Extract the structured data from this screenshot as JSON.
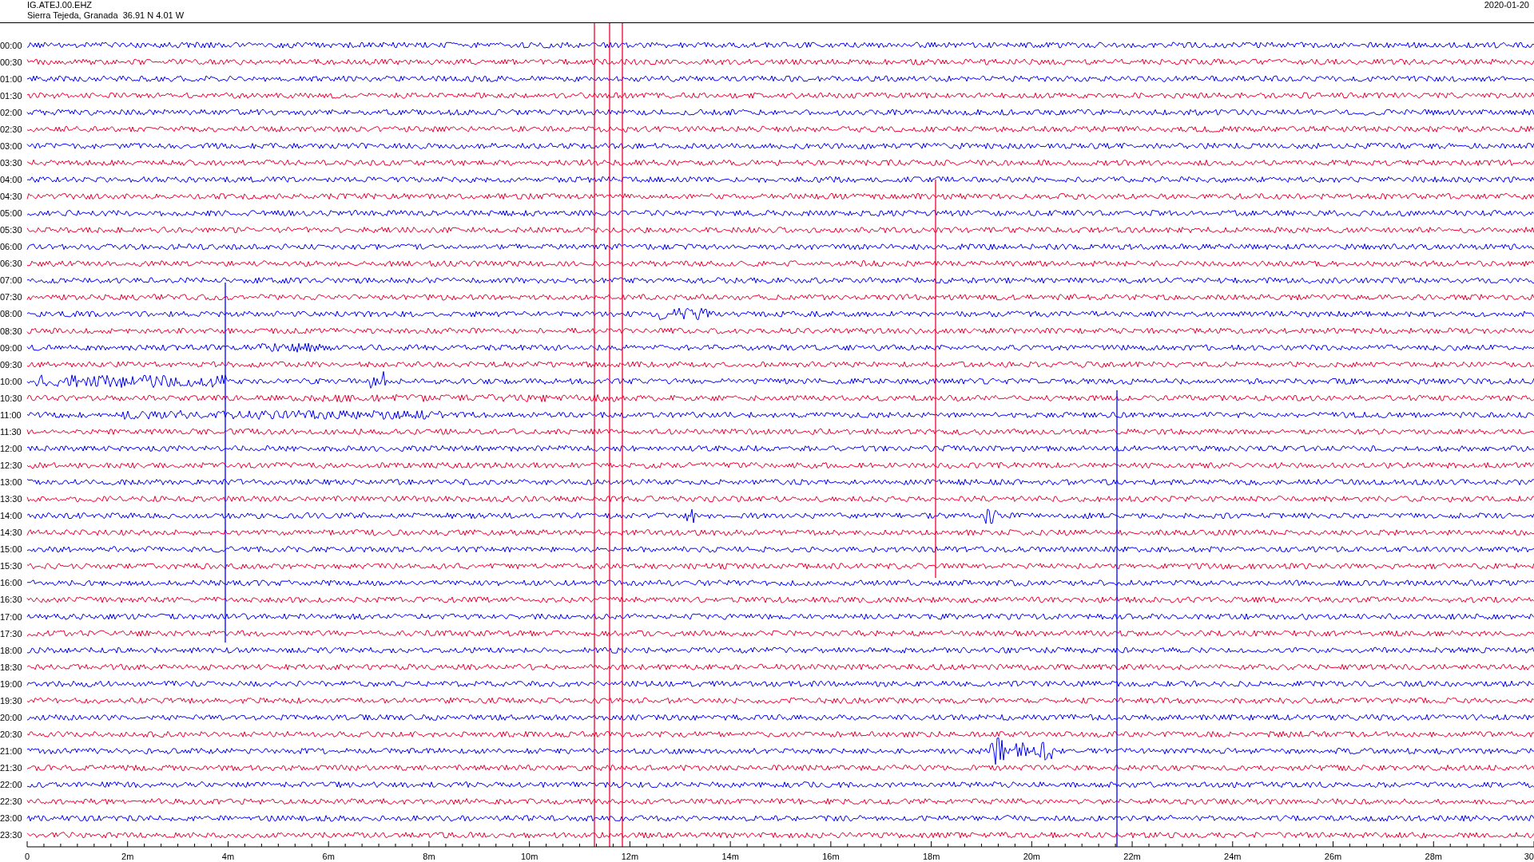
{
  "station": {
    "code": "IG.ATEJ.00.EHZ",
    "location": "Sierra Tejeda, Granada  36.91 N 4.01 W",
    "date": "2020-01-20"
  },
  "traces": [
    {
      "time": "00:00",
      "color": "#0000ff"
    },
    {
      "time": "00:30",
      "color": "#f00030"
    },
    {
      "time": "01:00",
      "color": "#0000ff"
    },
    {
      "time": "01:30",
      "color": "#f00030"
    },
    {
      "time": "02:00",
      "color": "#0000ff"
    },
    {
      "time": "02:30",
      "color": "#f00030"
    },
    {
      "time": "03:00",
      "color": "#0000ff"
    },
    {
      "time": "03:30",
      "color": "#f00030"
    },
    {
      "time": "04:00",
      "color": "#0000ff"
    },
    {
      "time": "04:30",
      "color": "#f00030"
    },
    {
      "time": "05:00",
      "color": "#0000ff"
    },
    {
      "time": "05:30",
      "color": "#f00030"
    },
    {
      "time": "06:00",
      "color": "#0000ff"
    },
    {
      "time": "06:30",
      "color": "#f00030"
    },
    {
      "time": "07:00",
      "color": "#0000ff"
    },
    {
      "time": "07:30",
      "color": "#f00030"
    },
    {
      "time": "08:00",
      "color": "#0000ff"
    },
    {
      "time": "08:30",
      "color": "#f00030"
    },
    {
      "time": "09:00",
      "color": "#0000ff"
    },
    {
      "time": "09:30",
      "color": "#f00030"
    },
    {
      "time": "10:00",
      "color": "#0000ff"
    },
    {
      "time": "10:30",
      "color": "#f00030"
    },
    {
      "time": "11:00",
      "color": "#0000ff"
    },
    {
      "time": "11:30",
      "color": "#f00030"
    },
    {
      "time": "12:00",
      "color": "#0000ff"
    },
    {
      "time": "12:30",
      "color": "#f00030"
    },
    {
      "time": "13:00",
      "color": "#0000ff"
    },
    {
      "time": "13:30",
      "color": "#f00030"
    },
    {
      "time": "14:00",
      "color": "#0000ff"
    },
    {
      "time": "14:30",
      "color": "#f00030"
    },
    {
      "time": "15:00",
      "color": "#0000ff"
    },
    {
      "time": "15:30",
      "color": "#f00030"
    },
    {
      "time": "16:00",
      "color": "#0000ff"
    },
    {
      "time": "16:30",
      "color": "#f00030"
    },
    {
      "time": "17:00",
      "color": "#0000ff"
    },
    {
      "time": "17:30",
      "color": "#f00030"
    },
    {
      "time": "18:00",
      "color": "#0000ff"
    },
    {
      "time": "18:30",
      "color": "#f00030"
    },
    {
      "time": "19:00",
      "color": "#0000ff"
    },
    {
      "time": "19:30",
      "color": "#f00030"
    },
    {
      "time": "20:00",
      "color": "#0000ff"
    },
    {
      "time": "20:30",
      "color": "#f00030"
    },
    {
      "time": "21:00",
      "color": "#0000ff"
    },
    {
      "time": "21:30",
      "color": "#f00030"
    },
    {
      "time": "22:00",
      "color": "#0000ff"
    },
    {
      "time": "22:30",
      "color": "#f00030"
    },
    {
      "time": "23:00",
      "color": "#0000ff"
    },
    {
      "time": "23:30",
      "color": "#f00030"
    }
  ],
  "axis": {
    "ticks": [
      "0",
      "2m",
      "4m",
      "6m",
      "8m",
      "10m",
      "12m",
      "14m",
      "16m",
      "18m",
      "20m",
      "22m",
      "24m",
      "26m",
      "28m",
      "30"
    ]
  }
}
